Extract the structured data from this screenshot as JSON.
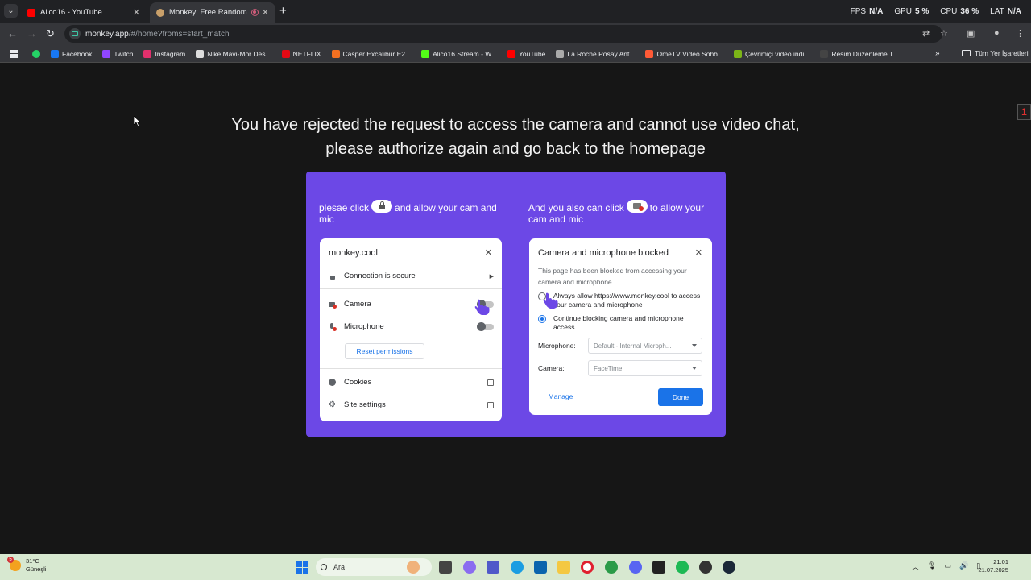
{
  "browser": {
    "tabs": [
      {
        "title": "Alico16 - YouTube",
        "favicon_color": "#ff0000"
      },
      {
        "title": "Monkey: Free Random Vide",
        "favicon_color": "#c9a06a"
      }
    ],
    "perf": {
      "fps_label": "FPS",
      "fps_value": "N/A",
      "gpu_label": "GPU",
      "gpu_value": "5 %",
      "cpu_label": "CPU",
      "cpu_value": "36 %",
      "lat_label": "LAT",
      "lat_value": "N/A"
    },
    "url_host": "monkey.app",
    "url_path": "/#/home?froms=start_match",
    "bookmarks": [
      {
        "label": "Facebook",
        "color": "#1877f2"
      },
      {
        "label": "Twitch",
        "color": "#9146ff"
      },
      {
        "label": "Instagram",
        "color": "#e1306c"
      },
      {
        "label": "Nike Mavi-Mor Des...",
        "color": "#dddddd"
      },
      {
        "label": "NETFLIX",
        "color": "#e50914"
      },
      {
        "label": "Casper Excalibur E2...",
        "color": "#f37021"
      },
      {
        "label": "Alico16 Stream - W...",
        "color": "#53fc18"
      },
      {
        "label": "YouTube",
        "color": "#ff0000"
      },
      {
        "label": "La Roche Posay Ant...",
        "color": "#aaaaaa"
      },
      {
        "label": "OmeTV Video Sohb...",
        "color": "#ff5a36"
      },
      {
        "label": "Çevrimiçi video indi...",
        "color": "#7cb518"
      },
      {
        "label": "Resim Düzenleme T...",
        "color": "#444444"
      }
    ],
    "all_bookmarks": "Tüm Yer İşaretleri"
  },
  "page": {
    "side_badge": "1",
    "headline": "You have rejected the request to access the camera and cannot use video chat, please authorize again and go back to the homepage",
    "left": {
      "instr_before": "plesae click",
      "instr_after": "and allow your cam and mic",
      "host": "monkey.cool",
      "connection": "Connection is secure",
      "camera": "Camera",
      "microphone": "Microphone",
      "reset": "Reset permissions",
      "cookies": "Cookies",
      "site_settings": "Site settings"
    },
    "right": {
      "instr_before": "And you also can click",
      "instr_after": "to allow your cam and mic",
      "title": "Camera and microphone blocked",
      "desc": "This page has been blocked from accessing your camera and microphone.",
      "opt_allow": "Always allow https://www.monkey.cool to access your camera and microphone",
      "opt_block": "Continue blocking camera and microphone access",
      "mic_label": "Microphone:",
      "mic_value": "Default - Internal Microph...",
      "cam_label": "Camera:",
      "cam_value": "FaceTime",
      "manage": "Manage",
      "done": "Done"
    },
    "accent": "#6c48e6"
  },
  "taskbar": {
    "weather_badge": "5",
    "temp": "31°C",
    "condition": "Güneşli",
    "search": "Ara",
    "time": "21:01",
    "date": "21.07.2025"
  }
}
